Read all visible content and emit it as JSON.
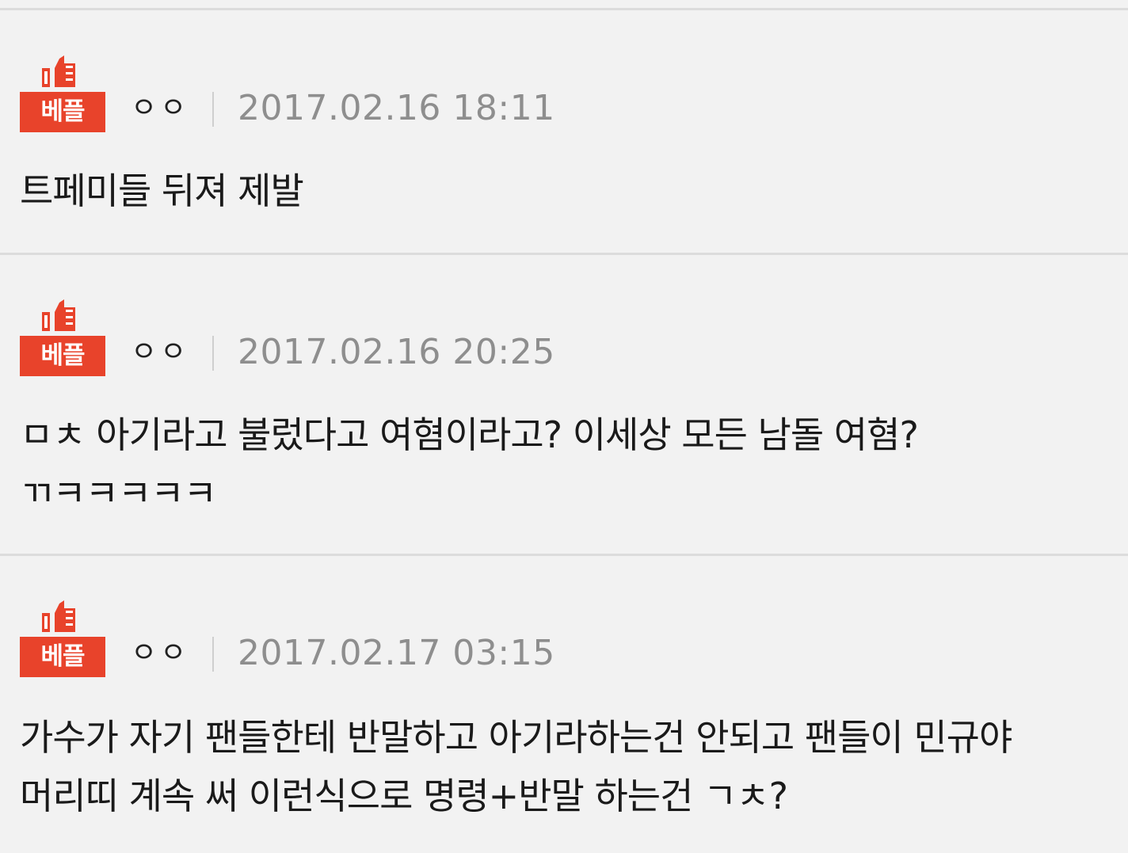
{
  "badge_colors": {
    "fill": "#e8432b",
    "text": "#ffffff"
  },
  "comments": [
    {
      "badge": "베플",
      "badge_icon": "thumbs-up-icon",
      "user": "ㅇㅇ",
      "date": "2017.02.16 18:11",
      "text": "트페미들 뒤져 제발"
    },
    {
      "badge": "베플",
      "badge_icon": "thumbs-up-icon",
      "user": "ㅇㅇ",
      "date": "2017.02.16 20:25",
      "text": "ㅁㅊ 아기라고 불렀다고 여혐이라고? 이세상 모든 남돌 여혐?ㄲㅋㅋㅋㅋㅋ"
    },
    {
      "badge": "베플",
      "badge_icon": "thumbs-up-icon",
      "user": "ㅇㅇ",
      "date": "2017.02.17 03:15",
      "text": "가수가 자기 팬들한테 반말하고 아기라하는건 안되고 팬들이 민규야 머리띠 계속 써 이런식으로 명령+반말 하는건 ㄱㅊ?"
    }
  ]
}
